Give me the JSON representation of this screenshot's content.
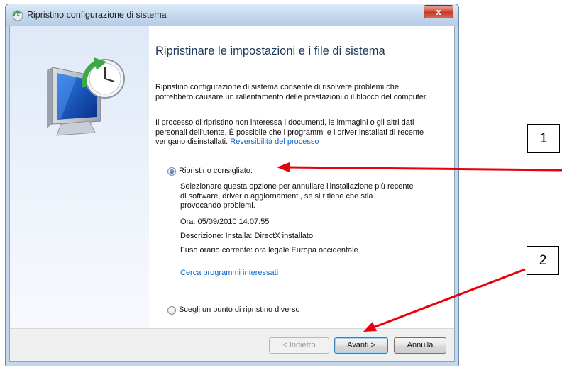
{
  "window": {
    "title": "Ripristino configurazione di sistema",
    "close_glyph": "x"
  },
  "heading": "Ripristinare le impostazioni e i file di sistema",
  "intro": "Ripristino configurazione di sistema consente di risolvere problemi che potrebbero causare un rallentamento delle prestazioni o il blocco del computer.",
  "info": {
    "text": "Il processo di ripristino non interessa i documenti, le immagini o gli altri dati personali dell'utente. È possibile che i programmi e i driver installati di recente vengano disinstallati.",
    "link": "Reversibilità del processo"
  },
  "options": {
    "recommended": {
      "label": "Ripristino consigliato:",
      "checked": true,
      "description": "Selezionare questa opzione per annullare l'installazione più recente di software, driver o aggiornamenti, se si ritiene che stia provocando problemi.",
      "time": "Ora: 05/09/2010 14:07:55",
      "desc": "Descrizione: Installa: DirectX installato",
      "timezone": "Fuso orario corrente: ora legale Europa occidentale",
      "scan_link": "Cerca programmi interessati"
    },
    "other": {
      "label": "Scegli un punto di ripristino diverso",
      "checked": false
    }
  },
  "buttons": {
    "back": "< Indietro",
    "next": "Avanti >",
    "cancel": "Annulla"
  },
  "annotations": {
    "box1": "1",
    "box2": "2",
    "arrow_color": "#e8000b"
  },
  "icons": {
    "title": "system-restore-icon",
    "sidebar": "system-restore-monitor-clock-icon"
  }
}
